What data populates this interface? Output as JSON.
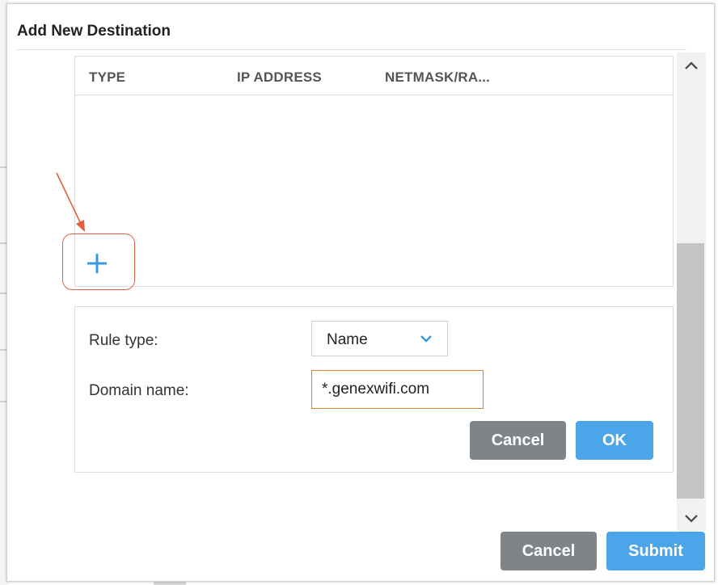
{
  "dialog": {
    "title": "Add New Destination"
  },
  "table": {
    "columns": [
      "TYPE",
      "IP ADDRESS",
      "NETMASK/RA..."
    ],
    "rows": []
  },
  "add_button": {
    "icon": "plus-icon",
    "color": "#3a9ae0"
  },
  "annotation": {
    "color": "#e0613c"
  },
  "rule_form": {
    "rule_type_label": "Rule type:",
    "rule_type_value": "Name",
    "domain_label": "Domain name:",
    "domain_value": "*.genexwifi.com",
    "cancel_label": "Cancel",
    "ok_label": "OK"
  },
  "footer": {
    "cancel_label": "Cancel",
    "submit_label": "Submit"
  },
  "colors": {
    "primary_button": "#4aa6e8",
    "secondary_button": "#7f8489",
    "focused_input_border": "#d9822b"
  }
}
